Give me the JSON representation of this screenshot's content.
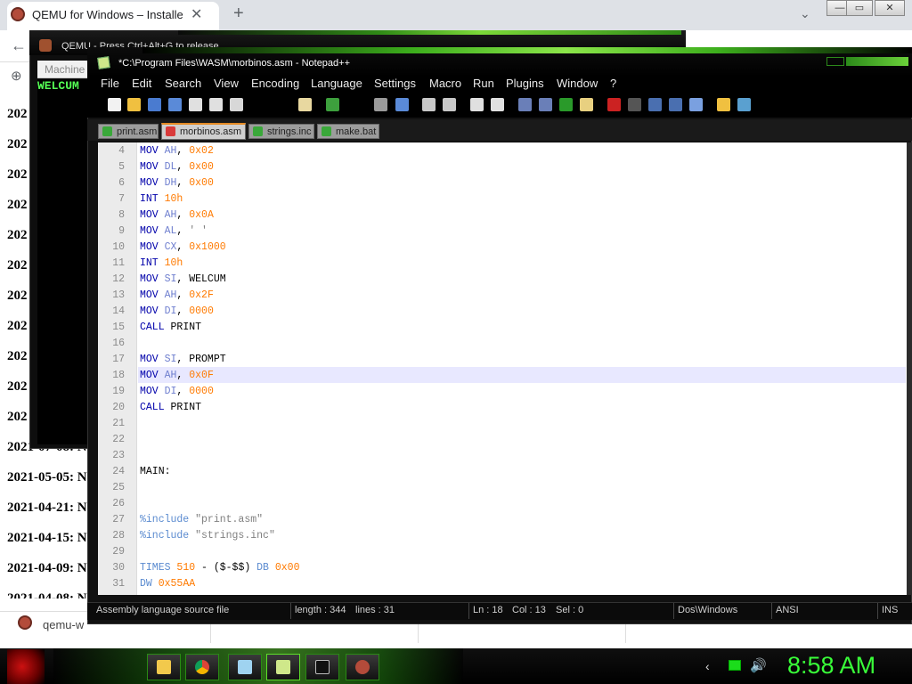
{
  "chrome": {
    "tab_title": "QEMU for Windows – Installers (",
    "close_glyph": "✕",
    "newtab_glyph": "+",
    "tabsearch_glyph": "⌄",
    "back_glyph": "←",
    "bookmark_glyph": "⊕",
    "dates": [
      "202",
      "202",
      "202",
      "202",
      "202",
      "202",
      "202",
      "202",
      "202",
      "202",
      "202",
      "2021-07-08: N",
      "2021-05-05: N",
      "2021-04-21: N",
      "2021-04-15: N",
      "2021-04-09: N",
      "2021-04-08: N"
    ],
    "download_name": "qemu-w",
    "window_controls": [
      "—",
      "▭",
      "✕"
    ]
  },
  "qemu": {
    "title": "QEMU - Press Ctrl+Alt+G to release",
    "menu_label": "Machine",
    "screen_text": "WELCUM"
  },
  "npp": {
    "title": "*C:\\Program Files\\WASM\\morbinos.asm - Notepad++",
    "menu": [
      "File",
      "Edit",
      "Search",
      "View",
      "Encoding",
      "Language",
      "Settings",
      "Macro",
      "Run",
      "Plugins",
      "Window",
      "?"
    ],
    "tabs": [
      {
        "label": "print.asm",
        "icon_color": "#3aa83a"
      },
      {
        "label": "morbinos.asm",
        "icon_color": "#d93a3a"
      },
      {
        "label": "strings.inc",
        "icon_color": "#3aa83a"
      },
      {
        "label": "make.bat",
        "icon_color": "#3aa83a"
      }
    ],
    "lines": [
      {
        "n": "4",
        "t": [
          [
            "MOV ",
            "kw"
          ],
          [
            "AH",
            "rg"
          ],
          [
            ", ",
            "tx"
          ],
          [
            "0x02",
            "nm"
          ]
        ]
      },
      {
        "n": "5",
        "t": [
          [
            "MOV ",
            "kw"
          ],
          [
            "DL",
            "rg"
          ],
          [
            ", ",
            "tx"
          ],
          [
            "0x00",
            "nm"
          ]
        ]
      },
      {
        "n": "6",
        "t": [
          [
            "MOV ",
            "kw"
          ],
          [
            "DH",
            "rg"
          ],
          [
            ", ",
            "tx"
          ],
          [
            "0x00",
            "nm"
          ]
        ]
      },
      {
        "n": "7",
        "t": [
          [
            "INT ",
            "kw"
          ],
          [
            "10h",
            "nm"
          ]
        ]
      },
      {
        "n": "8",
        "t": [
          [
            "MOV ",
            "kw"
          ],
          [
            "AH",
            "rg"
          ],
          [
            ", ",
            "tx"
          ],
          [
            "0x0A",
            "nm"
          ]
        ]
      },
      {
        "n": "9",
        "t": [
          [
            "MOV ",
            "kw"
          ],
          [
            "AL",
            "rg"
          ],
          [
            ", ",
            "tx"
          ],
          [
            "' '",
            "st"
          ]
        ]
      },
      {
        "n": "10",
        "t": [
          [
            "MOV ",
            "kw"
          ],
          [
            "CX",
            "rg"
          ],
          [
            ", ",
            "tx"
          ],
          [
            "0x1000",
            "nm"
          ]
        ]
      },
      {
        "n": "11",
        "t": [
          [
            "INT ",
            "kw"
          ],
          [
            "10h",
            "nm"
          ]
        ]
      },
      {
        "n": "12",
        "t": [
          [
            "MOV ",
            "kw"
          ],
          [
            "SI",
            "rg"
          ],
          [
            ", WELCUM",
            "tx"
          ]
        ]
      },
      {
        "n": "13",
        "t": [
          [
            "MOV ",
            "kw"
          ],
          [
            "AH",
            "rg"
          ],
          [
            ", ",
            "tx"
          ],
          [
            "0x2F",
            "nm"
          ]
        ]
      },
      {
        "n": "14",
        "t": [
          [
            "MOV ",
            "kw"
          ],
          [
            "DI",
            "rg"
          ],
          [
            ", ",
            "tx"
          ],
          [
            "0000",
            "nm"
          ]
        ]
      },
      {
        "n": "15",
        "t": [
          [
            "CALL ",
            "kw"
          ],
          [
            "PRINT",
            "tx"
          ]
        ]
      },
      {
        "n": "16",
        "t": []
      },
      {
        "n": "17",
        "t": [
          [
            "MOV ",
            "kw"
          ],
          [
            "SI",
            "rg"
          ],
          [
            ", PROMPT",
            "tx"
          ]
        ]
      },
      {
        "n": "18",
        "t": [
          [
            "MOV ",
            "kw"
          ],
          [
            "AH",
            "rg"
          ],
          [
            ", ",
            "tx"
          ],
          [
            "0x0F",
            "nm"
          ]
        ]
      },
      {
        "n": "19",
        "t": [
          [
            "MOV ",
            "kw"
          ],
          [
            "DI",
            "rg"
          ],
          [
            ", ",
            "tx"
          ],
          [
            "0000",
            "nm"
          ]
        ]
      },
      {
        "n": "20",
        "t": [
          [
            "CALL ",
            "kw"
          ],
          [
            "PRINT",
            "tx"
          ]
        ]
      },
      {
        "n": "21",
        "t": []
      },
      {
        "n": "22",
        "t": []
      },
      {
        "n": "23",
        "t": []
      },
      {
        "n": "24",
        "t": [
          [
            "MAIN:",
            "tx"
          ]
        ]
      },
      {
        "n": "25",
        "t": []
      },
      {
        "n": "26",
        "t": []
      },
      {
        "n": "27",
        "t": [
          [
            "%include ",
            "dr"
          ],
          [
            "\"print.asm\"",
            "st"
          ]
        ]
      },
      {
        "n": "28",
        "t": [
          [
            "%include ",
            "dr"
          ],
          [
            "\"strings.inc\"",
            "st"
          ]
        ]
      },
      {
        "n": "29",
        "t": []
      },
      {
        "n": "30",
        "t": [
          [
            "TIMES ",
            "dr"
          ],
          [
            "510",
            "nm"
          ],
          [
            " - ($-$$) ",
            "tx"
          ],
          [
            "DB ",
            "dr"
          ],
          [
            "0x00",
            "nm"
          ]
        ]
      },
      {
        "n": "31",
        "t": [
          [
            "DW ",
            "dr"
          ],
          [
            "0x55AA",
            "nm"
          ]
        ]
      }
    ],
    "current_line": "18",
    "status": {
      "type": "Assembly language source file",
      "length": "length : 344",
      "lines": "lines : 31",
      "ln": "Ln : 18",
      "col": "Col : 13",
      "sel": "Sel : 0",
      "eol": "Dos\\Windows",
      "enc": "ANSI",
      "mode": "INS"
    }
  },
  "taskbar": {
    "apps": [
      "file-explorer",
      "chrome",
      "notepad",
      "notepad-plus-plus",
      "command-prompt",
      "qemu"
    ],
    "tray_chevron": "‹",
    "tray_volume": "🔊",
    "clock": "8:58 AM"
  }
}
